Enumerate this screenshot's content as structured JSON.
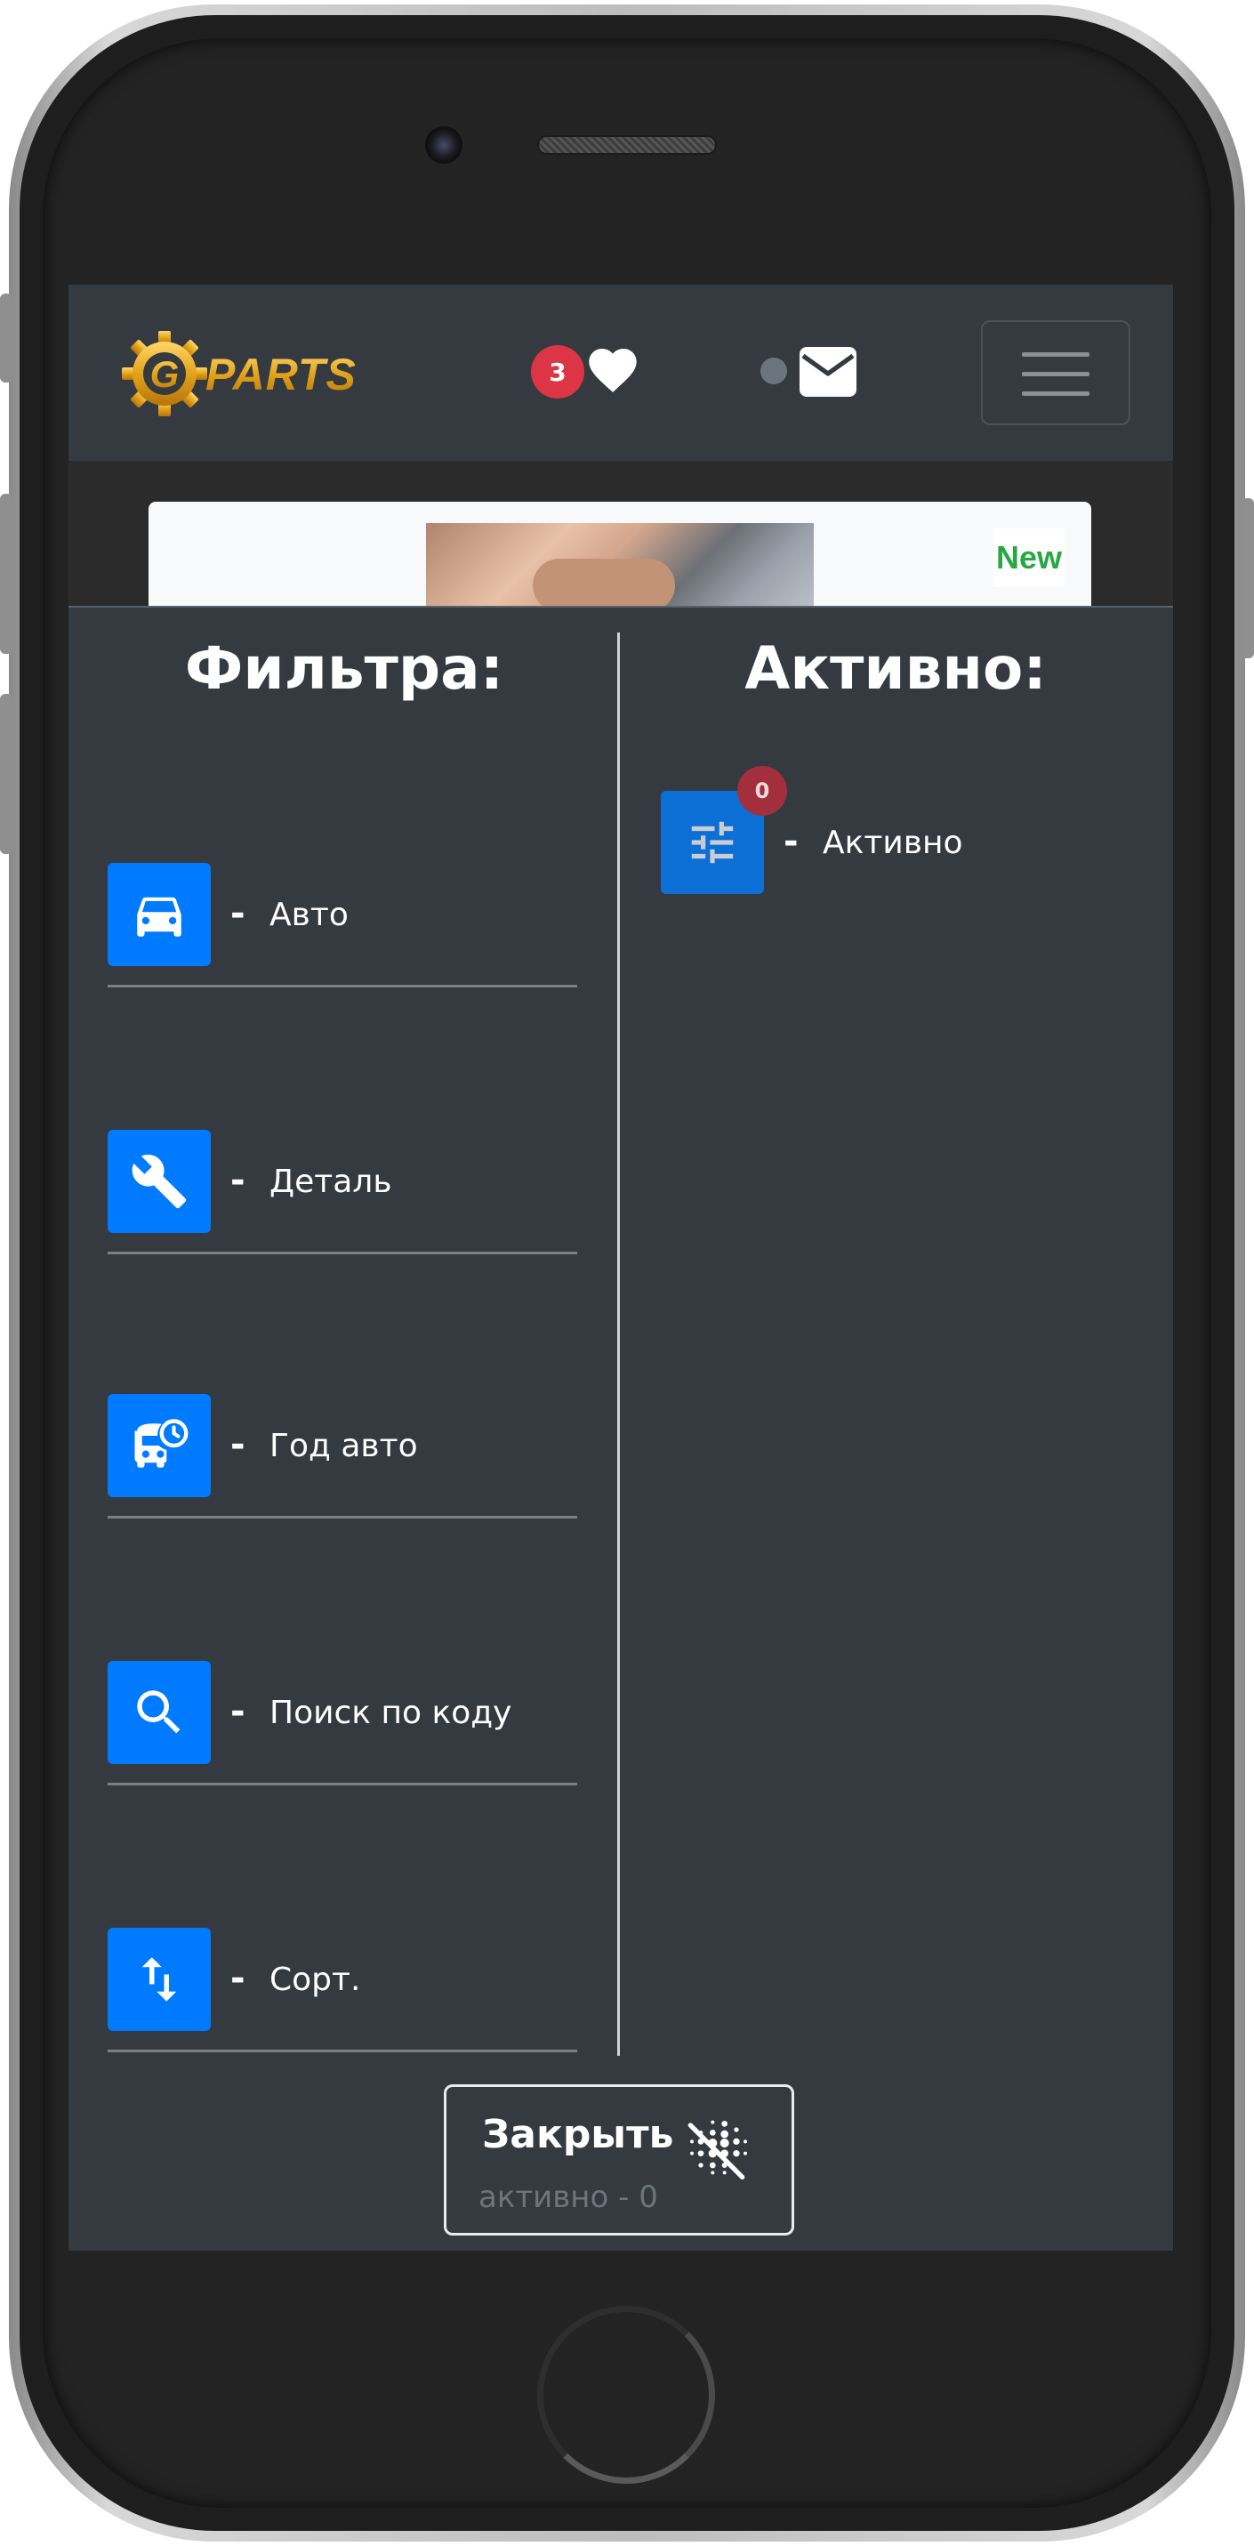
{
  "navbar": {
    "logo_text": "G PARTS",
    "favorites_count": "3"
  },
  "card": {
    "badge": "New"
  },
  "filters": {
    "title": "Фильтра:",
    "items": [
      {
        "icon": "car-icon",
        "label": "Авто"
      },
      {
        "icon": "wrench-icon",
        "label": "Деталь"
      },
      {
        "icon": "bus-clock-icon",
        "label": "Год авто"
      },
      {
        "icon": "search-icon",
        "label": "Поиск по коду"
      },
      {
        "icon": "sort-icon",
        "label": "Сорт."
      }
    ],
    "separator": "-"
  },
  "active": {
    "title": "Активно:",
    "item": {
      "icon": "sliders-icon",
      "label": "Активно",
      "count": "0"
    }
  },
  "close": {
    "label": "Закрыть",
    "status": "активно - 0"
  },
  "colors": {
    "panel_bg": "#343a40",
    "accent": "#007bff",
    "badge_red": "#dc3545",
    "new_green": "#28a745"
  }
}
